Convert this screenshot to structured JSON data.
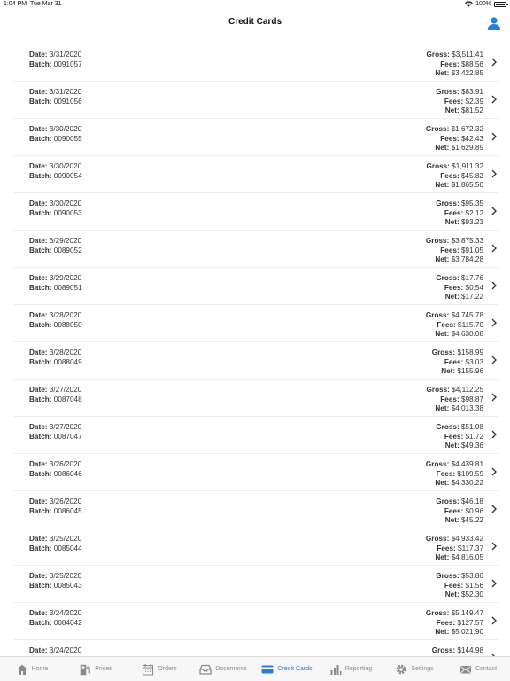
{
  "status": {
    "time": "1:04 PM",
    "date": "Tue Mar 31",
    "battery": "100%"
  },
  "header": {
    "title": "Credit Cards"
  },
  "labels": {
    "date": "Date:",
    "batch": "Batch:",
    "gross": "Gross:",
    "fees": "Fees:",
    "net": "Net:"
  },
  "rows": [
    {
      "date": "3/31/2020",
      "batch": "0091057",
      "gross": "$3,511.41",
      "fees": "$88.56",
      "net": "$3,422.85"
    },
    {
      "date": "3/31/2020",
      "batch": "0091056",
      "gross": "$83.91",
      "fees": "$2.39",
      "net": "$81.52"
    },
    {
      "date": "3/30/2020",
      "batch": "0090055",
      "gross": "$1,672.32",
      "fees": "$42.43",
      "net": "$1,629.89"
    },
    {
      "date": "3/30/2020",
      "batch": "0090054",
      "gross": "$1,911.32",
      "fees": "$45.82",
      "net": "$1,865.50"
    },
    {
      "date": "3/30/2020",
      "batch": "0090053",
      "gross": "$95.35",
      "fees": "$2.12",
      "net": "$93.23"
    },
    {
      "date": "3/29/2020",
      "batch": "0089052",
      "gross": "$3,875.33",
      "fees": "$91.05",
      "net": "$3,784.28"
    },
    {
      "date": "3/29/2020",
      "batch": "0089051",
      "gross": "$17.76",
      "fees": "$0.54",
      "net": "$17.22"
    },
    {
      "date": "3/28/2020",
      "batch": "0088050",
      "gross": "$4,745.78",
      "fees": "$115.70",
      "net": "$4,630.08"
    },
    {
      "date": "3/28/2020",
      "batch": "0088049",
      "gross": "$158.99",
      "fees": "$3.03",
      "net": "$155.96"
    },
    {
      "date": "3/27/2020",
      "batch": "0087048",
      "gross": "$4,112.25",
      "fees": "$98.87",
      "net": "$4,013.38"
    },
    {
      "date": "3/27/2020",
      "batch": "0087047",
      "gross": "$51.08",
      "fees": "$1.72",
      "net": "$49.36"
    },
    {
      "date": "3/26/2020",
      "batch": "0086046",
      "gross": "$4,439.81",
      "fees": "$109.59",
      "net": "$4,330.22"
    },
    {
      "date": "3/26/2020",
      "batch": "0086045",
      "gross": "$46.18",
      "fees": "$0.96",
      "net": "$45.22"
    },
    {
      "date": "3/25/2020",
      "batch": "0085044",
      "gross": "$4,933.42",
      "fees": "$117.37",
      "net": "$4,816.05"
    },
    {
      "date": "3/25/2020",
      "batch": "0085043",
      "gross": "$53.86",
      "fees": "$1.56",
      "net": "$52.30"
    },
    {
      "date": "3/24/2020",
      "batch": "0084042",
      "gross": "$5,149.47",
      "fees": "$127.57",
      "net": "$5,021.90"
    },
    {
      "date": "3/24/2020",
      "batch": "",
      "gross": "$144.98",
      "fees": "",
      "net": ""
    }
  ],
  "tabs": [
    {
      "label": "Home",
      "icon": "home-icon",
      "active": false
    },
    {
      "label": "Prices",
      "icon": "fuel-pump-icon",
      "active": false
    },
    {
      "label": "Orders",
      "icon": "calendar-icon",
      "active": false
    },
    {
      "label": "Documents",
      "icon": "inbox-icon",
      "active": false
    },
    {
      "label": "Credit Cards",
      "icon": "credit-card-icon",
      "active": true
    },
    {
      "label": "Reporting",
      "icon": "bar-chart-icon",
      "active": false
    },
    {
      "label": "Settings",
      "icon": "gear-icon",
      "active": false
    },
    {
      "label": "Contact",
      "icon": "envelope-icon",
      "active": false
    }
  ],
  "colors": {
    "accent": "#2a7fdb",
    "inactive": "#8a8a8a"
  }
}
